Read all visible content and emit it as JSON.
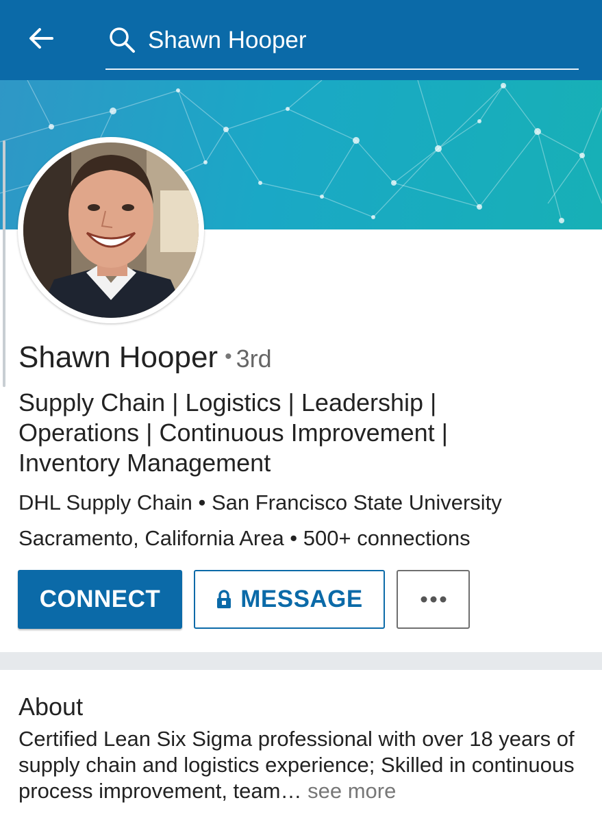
{
  "header": {
    "search_value": "Shawn Hooper",
    "colors": {
      "bar": "#0b6aa8",
      "text": "#ffffff"
    },
    "icons": {
      "back": "arrow-left-icon",
      "search": "search-icon"
    }
  },
  "profile": {
    "name": "Shawn Hooper",
    "separator": "•",
    "degree": "3rd",
    "headline_lines": [
      "Supply Chain | Logistics | Leadership |",
      "Operations | Continuous Improvement |",
      "Inventory Management"
    ],
    "company_school": "DHL Supply Chain • San Francisco State University",
    "location_connections": "Sacramento, California Area • 500+ connections"
  },
  "actions": {
    "connect_label": "CONNECT",
    "message_label": "MESSAGE",
    "more_label": "•••",
    "icons": {
      "message": "lock-icon",
      "more": "more-horizontal-icon"
    },
    "colors": {
      "primary": "#0b6aa8"
    }
  },
  "about": {
    "title": "About",
    "text": "Certified Lean Six Sigma professional with over 18 years of supply chain and logistics experience; Skilled in continuous process improvement, team…",
    "see_more": "see more"
  }
}
